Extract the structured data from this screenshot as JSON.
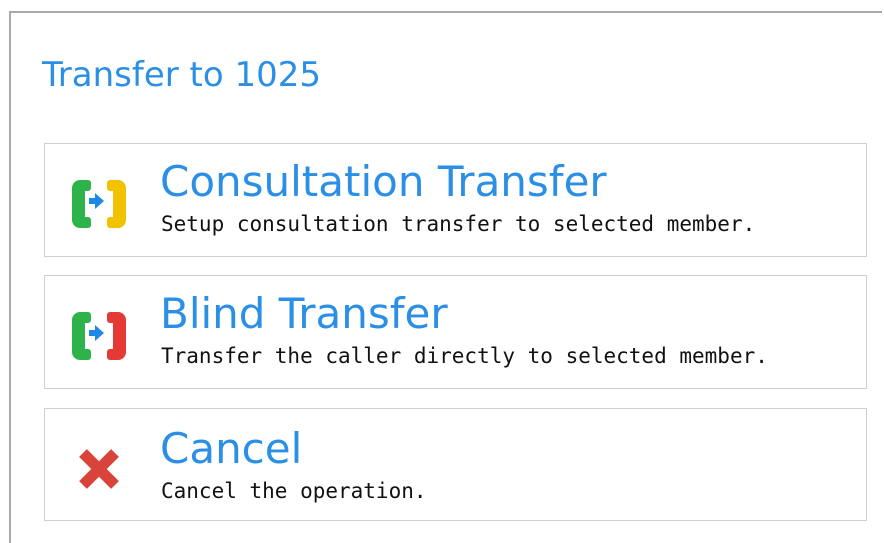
{
  "dialog": {
    "title": "Transfer to 1025"
  },
  "options": [
    {
      "label": "Consultation Transfer",
      "description": "Setup consultation transfer to selected member.",
      "icon": "consultation-transfer-icon",
      "colors": {
        "left_handset": "#2db34a",
        "arrow": "#1e88e5",
        "right_handset": "#f2c200"
      }
    },
    {
      "label": "Blind Transfer",
      "description": "Transfer the caller directly to selected member.",
      "icon": "blind-transfer-icon",
      "colors": {
        "left_handset": "#2db34a",
        "arrow": "#1e88e5",
        "right_handset": "#e53935"
      }
    },
    {
      "label": "Cancel",
      "description": "Cancel the operation.",
      "icon": "cancel-x-icon",
      "colors": {
        "x": "#d9443a"
      }
    }
  ],
  "theme": {
    "accent": "#2b8fe6",
    "border": "#cfcfcf",
    "text": "#111111"
  }
}
